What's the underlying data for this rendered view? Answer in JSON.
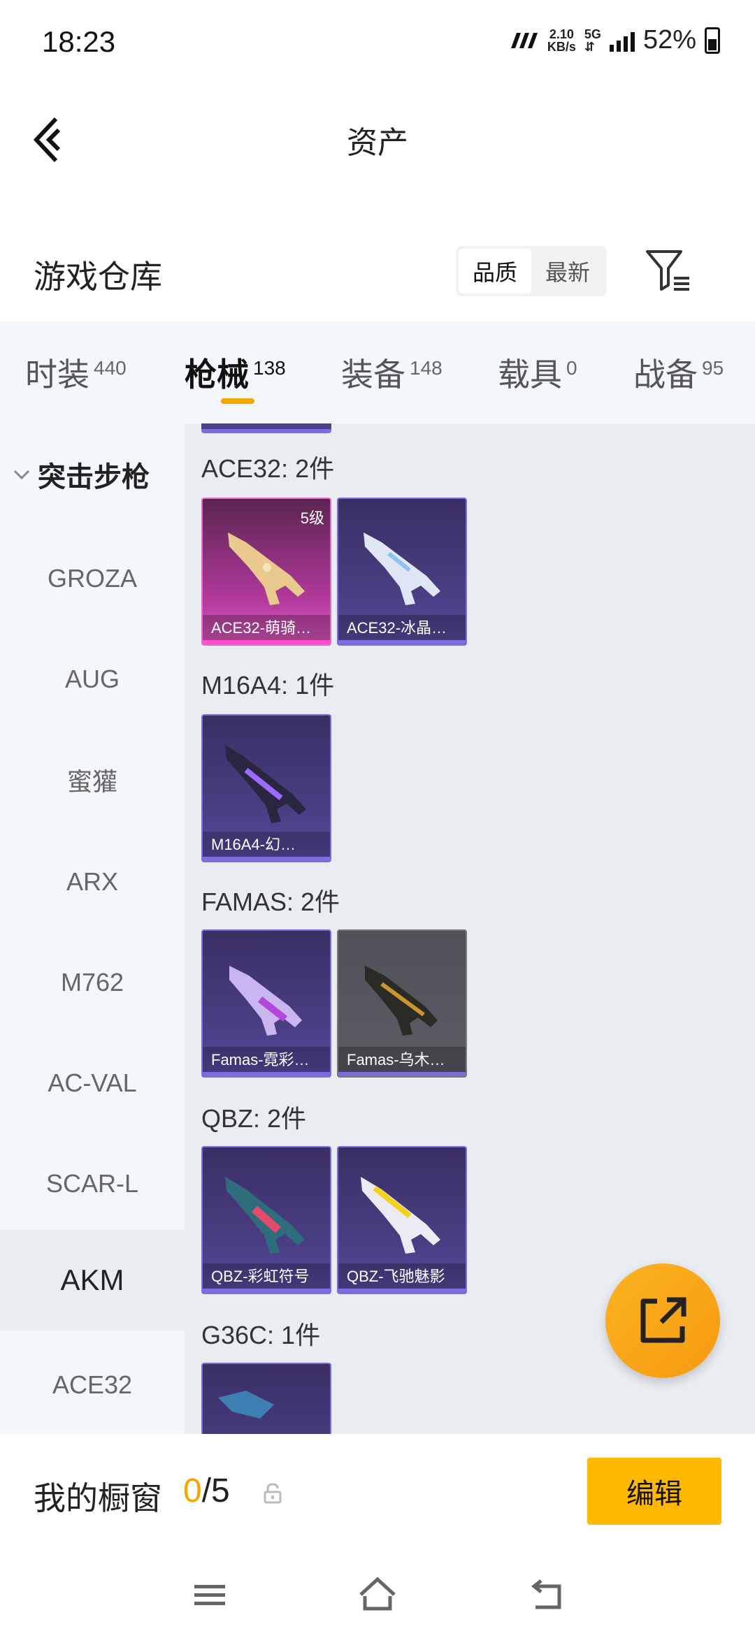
{
  "status_bar": {
    "time": "18:23",
    "net_speed_value": "2.10",
    "net_speed_unit": "KB/s",
    "network": "5G",
    "battery": "52%"
  },
  "header": {
    "title": "资产"
  },
  "warehouse": {
    "title": "游戏仓库",
    "sort_options": [
      "品质",
      "最新"
    ],
    "active_sort": "品质"
  },
  "tabs": [
    {
      "label": "时装",
      "count": "440"
    },
    {
      "label": "枪械",
      "count": "138"
    },
    {
      "label": "装备",
      "count": "148"
    },
    {
      "label": "载具",
      "count": "0"
    },
    {
      "label": "战备",
      "count": "95"
    }
  ],
  "sidebar": {
    "header": "突击步枪",
    "items": [
      "GROZA",
      "AUG",
      "蜜獾",
      "ARX",
      "M762",
      "AC-VAL",
      "SCAR-L",
      "AKM",
      "ACE32"
    ],
    "active": "AKM"
  },
  "groups": [
    {
      "title": "ACE32: 2件",
      "items": [
        {
          "name": "ACE32-萌骑…",
          "rarity": "pink",
          "level": "5级"
        },
        {
          "name": "ACE32-冰晶…",
          "rarity": "purple"
        }
      ]
    },
    {
      "title": "M16A4: 1件",
      "items": [
        {
          "name": "M16A4-幻…",
          "rarity": "purple"
        }
      ]
    },
    {
      "title": "FAMAS: 2件",
      "items": [
        {
          "name": "Famas-霓彩…",
          "rarity": "purple"
        },
        {
          "name": "Famas-乌木…",
          "rarity": "gray"
        }
      ]
    },
    {
      "title": "QBZ: 2件",
      "items": [
        {
          "name": "QBZ-彩虹符号",
          "rarity": "purple"
        },
        {
          "name": "QBZ-飞驰魅影",
          "rarity": "purple"
        }
      ]
    },
    {
      "title": "G36C: 1件",
      "items": [
        {
          "name": "",
          "rarity": "purple"
        }
      ]
    }
  ],
  "showcase": {
    "label": "我的橱窗",
    "current": "0",
    "separator": "/",
    "max": "5",
    "edit_label": "编辑"
  },
  "colors": {
    "accent": "#f5a500",
    "edit_button": "#ffb800"
  }
}
